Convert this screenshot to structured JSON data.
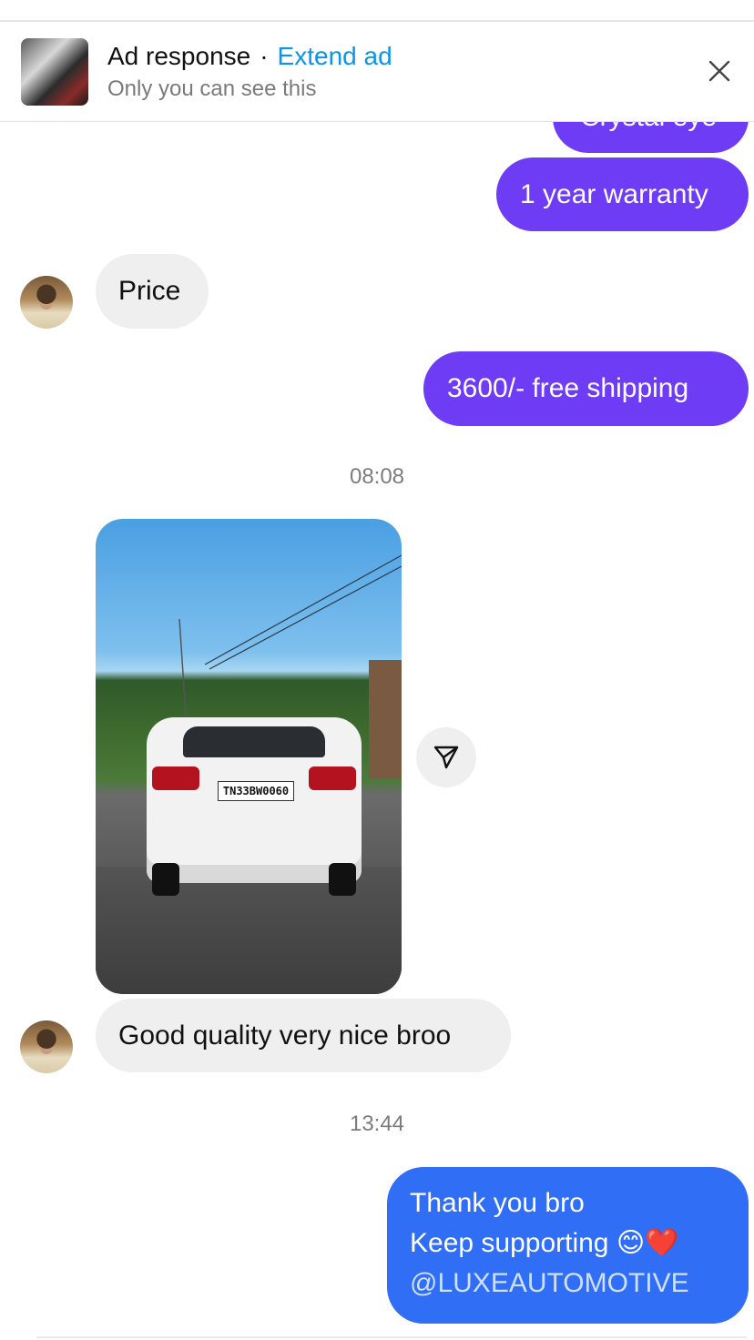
{
  "ad_banner": {
    "title": "Ad response",
    "separator": "·",
    "extend_label": "Extend ad",
    "subtitle": "Only you can see this",
    "close_icon": "close-icon"
  },
  "messages": {
    "partial_top": "Crystal eye",
    "warranty": "1 year warranty",
    "price": "Price",
    "offer": "3600/- free shipping",
    "time_1": "08:08",
    "photo_plate": "TN33BW0060",
    "feedback": "Good quality very nice broo",
    "time_2": "13:44",
    "reply_line1": "Thank you bro",
    "reply_line2": "Keep supporting",
    "reply_emoji": "😊❤️",
    "reply_handle": "@LUXEAUTOMOTIVE"
  },
  "icons": {
    "share": "share-send-icon",
    "avatar": "avatar"
  },
  "colors": {
    "outgoing_purple": "#6d3cf4",
    "outgoing_blue": "#2f6ef5",
    "incoming_gray": "#efefef",
    "link_blue": "#0a95e8"
  }
}
